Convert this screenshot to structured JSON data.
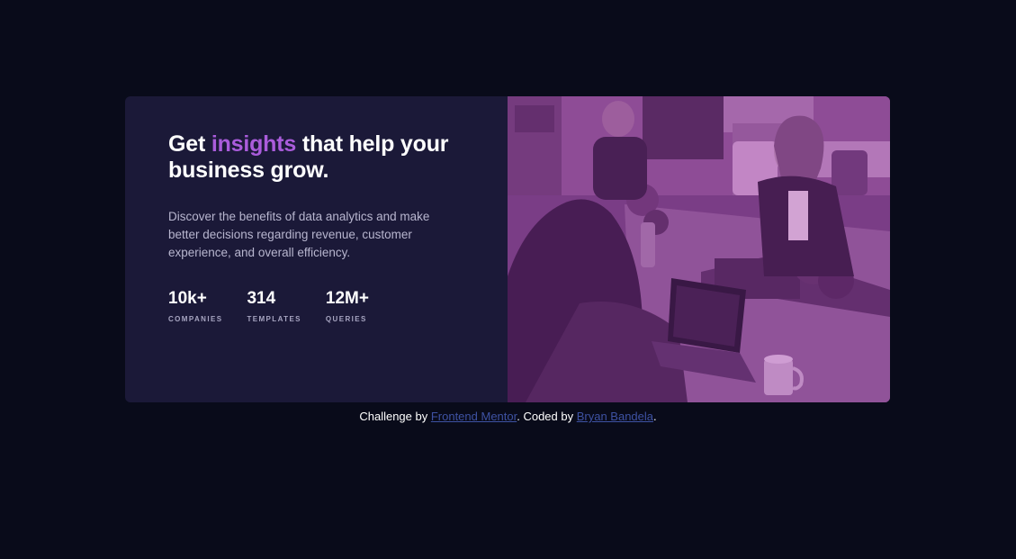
{
  "card": {
    "headline": {
      "before": "Get ",
      "accent": "insights",
      "after": " that help your business grow."
    },
    "description": "Discover the benefits of data analytics and make better decisions regarding revenue, customer experience, and overall efficiency.",
    "stats": [
      {
        "value": "10k+",
        "label": "COMPANIES"
      },
      {
        "value": "314",
        "label": "TEMPLATES"
      },
      {
        "value": "12M+",
        "label": "QUERIES"
      }
    ],
    "image": {
      "description": "photo"
    }
  },
  "attribution": {
    "prefix": "Challenge by ",
    "link1": "Frontend Mentor",
    "middle": ". Coded by ",
    "link2": "Bryan Bandela",
    "suffix": "."
  },
  "colors": {
    "page_background": "#090b1a",
    "card_background": "#1b1938",
    "accent": "#aa5cdb",
    "photo_tint": "#7a3e7d",
    "link": "#3e52a3"
  }
}
